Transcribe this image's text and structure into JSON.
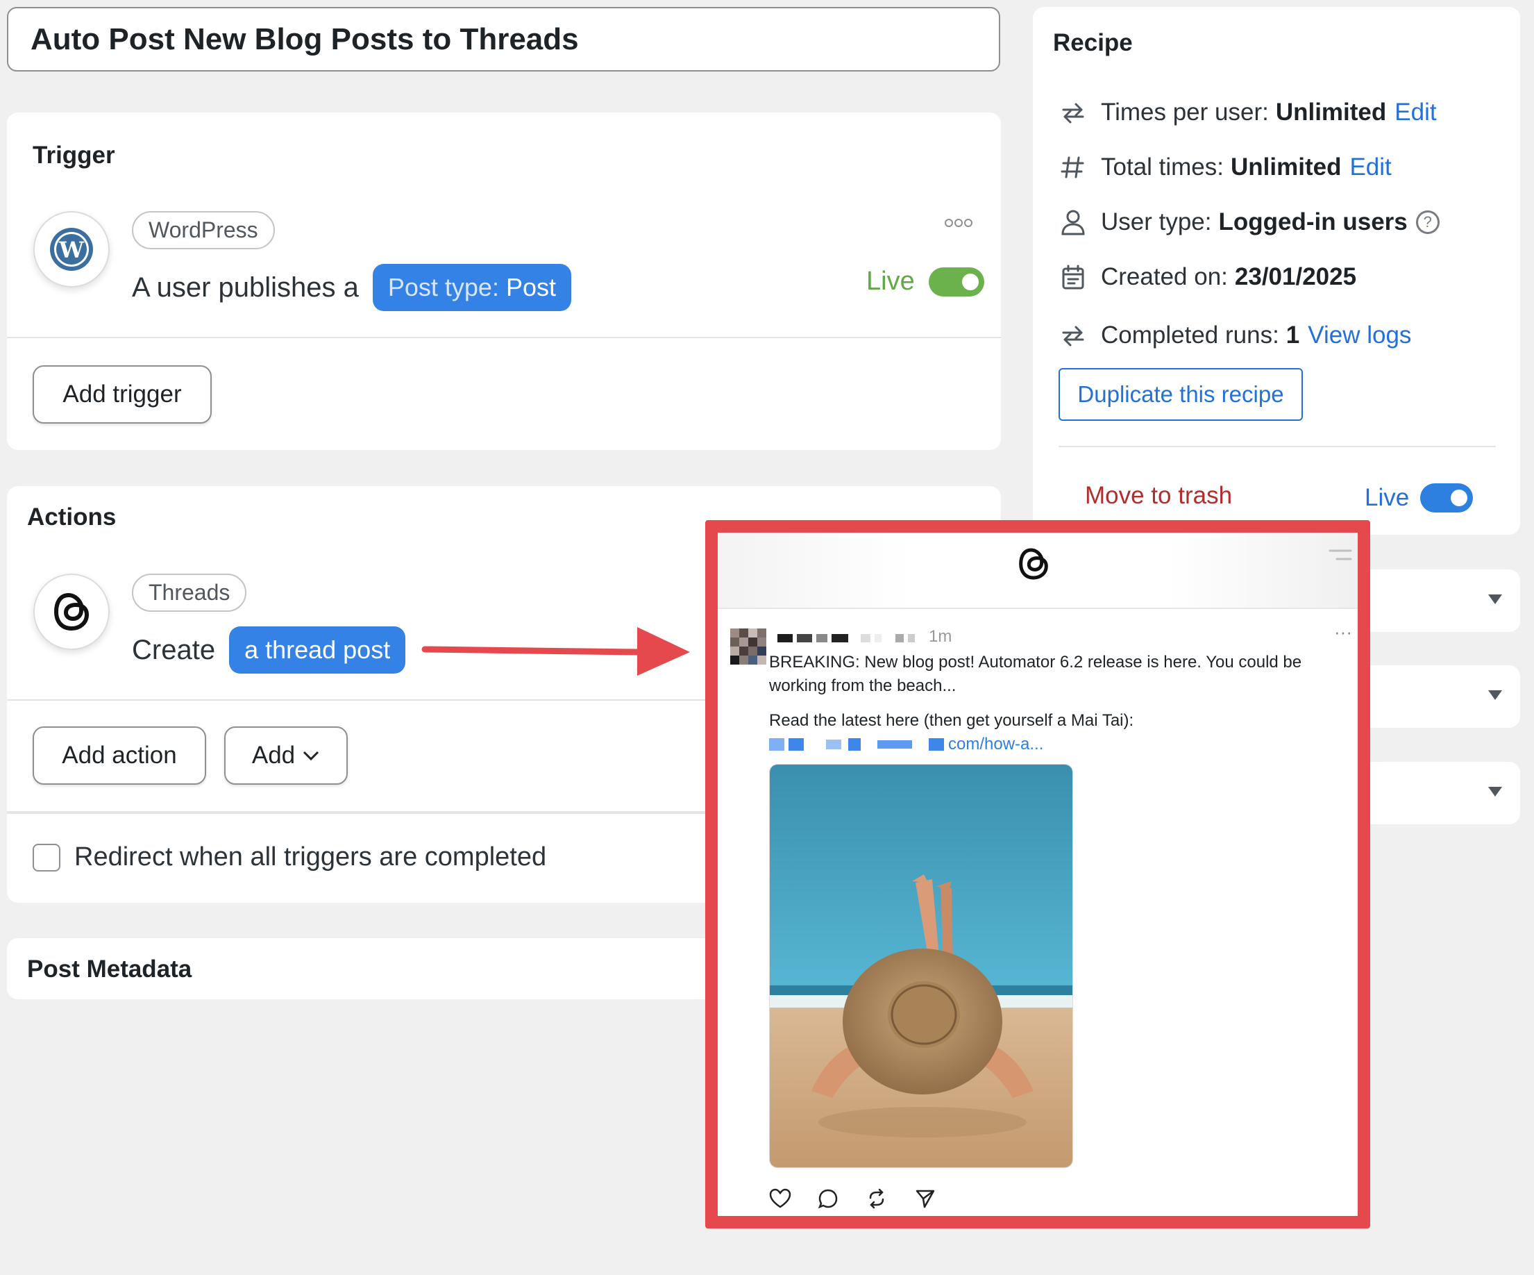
{
  "title": "Auto Post New Blog Posts to Threads",
  "trigger": {
    "heading": "Trigger",
    "integration": "WordPress",
    "sentence_prefix": "A user publishes a",
    "chip_label": "Post type:",
    "chip_value": "Post",
    "status": "Live",
    "menu_icon": "more-dots-icon",
    "add_button": "Add trigger"
  },
  "actions": {
    "heading": "Actions",
    "integration": "Threads",
    "sentence_prefix": "Create",
    "chip_value": "a thread post",
    "add_action_button": "Add action",
    "add_button": "Add",
    "redirect_label": "Redirect when all triggers are completed"
  },
  "post_metadata": {
    "heading": "Post Metadata"
  },
  "recipe": {
    "heading": "Recipe",
    "rows": [
      {
        "icon": "repeat-icon",
        "label": "Times per user:",
        "value": "Unlimited",
        "link": "Edit"
      },
      {
        "icon": "hash-icon",
        "label": "Total times:",
        "value": "Unlimited",
        "link": "Edit"
      },
      {
        "icon": "user-icon",
        "label": "User type:",
        "value": "Logged-in users",
        "help": "?"
      },
      {
        "icon": "calendar-icon",
        "label": "Created on:",
        "value": "23/01/2025"
      },
      {
        "icon": "repeat-icon",
        "label": "Completed runs:",
        "value": "1",
        "link": "View logs"
      }
    ],
    "duplicate_button": "Duplicate this recipe",
    "trash_link": "Move to trash",
    "status": "Live"
  },
  "threads_post": {
    "time": "1m",
    "more": "···",
    "line1": "BREAKING: New blog post! Automator 6.2 release is here. You could be",
    "line2": "working from the beach...",
    "line3": "Read the latest here (then get yourself a Mai Tai):",
    "link_suffix": "com/how-a..."
  },
  "colors": {
    "accent_blue": "#3582e6",
    "live_green": "#6bb24d",
    "trash_red": "#b32d2e",
    "highlight_red": "#e5484d"
  }
}
